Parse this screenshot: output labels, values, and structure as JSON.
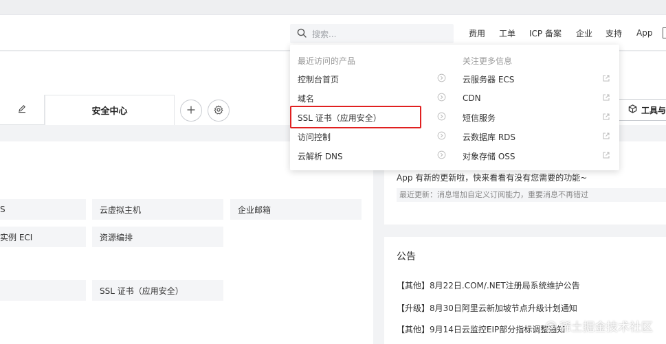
{
  "header": {
    "search_placeholder": "搜索...",
    "nav": [
      "费用",
      "工单",
      "ICP 备案",
      "企业",
      "支持",
      "App"
    ]
  },
  "tabs": {
    "security_center": "安全中心",
    "tools_label": "工具与"
  },
  "dropdown": {
    "recent_title": "最近访问的产品",
    "recent_items": [
      "控制台首页",
      "域名",
      "SSL 证书（应用安全）",
      "访问控制",
      "云解析 DNS"
    ],
    "more_title": "关注更多信息",
    "more_items": [
      "云服务器 ECS",
      "CDN",
      "短信服务",
      "云数据库 RDS",
      "对象存储 OSS"
    ]
  },
  "products": {
    "row1": [
      "S",
      "云虚拟主机",
      "企业邮箱"
    ],
    "row2": [
      "实例 ECI",
      "资源编排"
    ],
    "row3": [
      "SSL 证书（应用安全）"
    ]
  },
  "notification": {
    "message": "App 有新的更新啦，快来看看有没有您需要的功能~",
    "latest": "最近更新：消息增加自定义订阅能力，重要消息不再错过"
  },
  "announcements": {
    "title": "公告",
    "items": [
      "【其他】8月22日.COM/.NET注册局系统维护公告",
      "【升级】8月30日阿里云新加坡节点升级计划通知",
      "【其他】9月14日云监控EIP部分指标调整通知"
    ]
  },
  "watermark": "稀土掘金技术社区",
  "colors": {
    "highlight": "#e02020",
    "muted": "#999999",
    "surface": "#f4f5f7"
  }
}
